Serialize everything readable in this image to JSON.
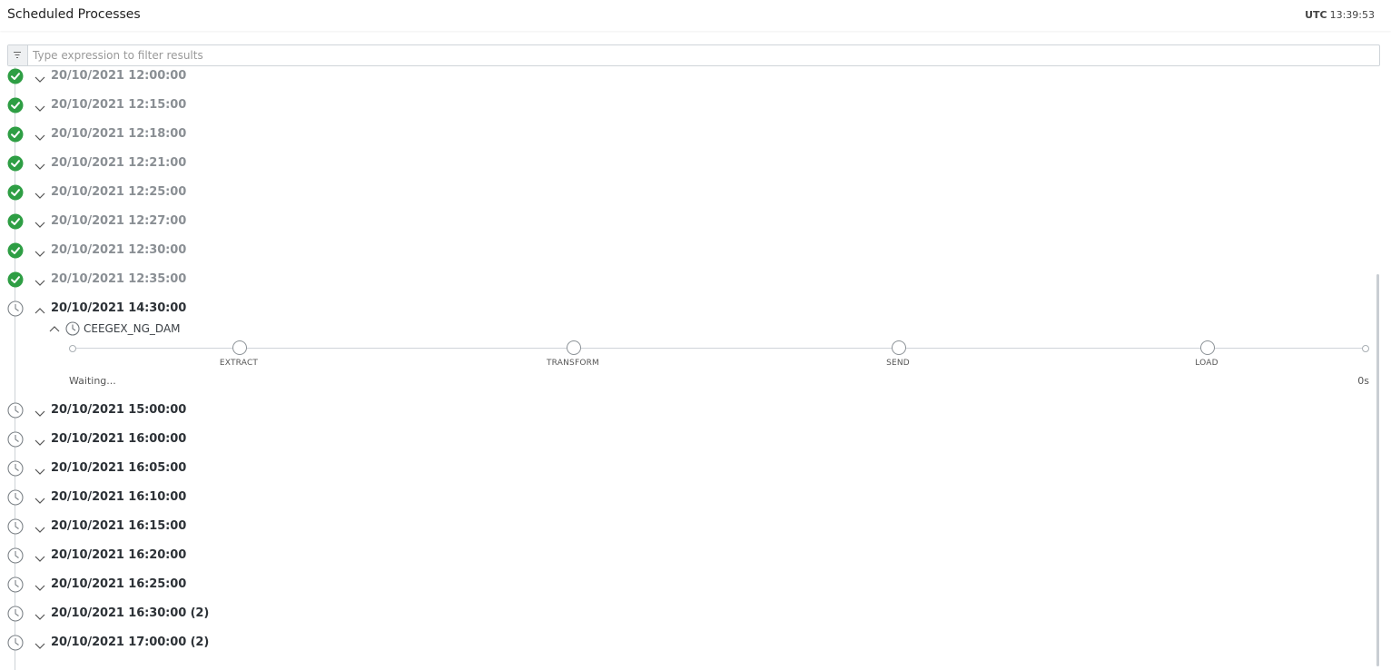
{
  "header": {
    "title": "Scheduled Processes",
    "timezone": "UTC",
    "time": "13:39:53"
  },
  "filter": {
    "placeholder": "Type expression to filter results",
    "value": "",
    "icon": "filter-icon"
  },
  "colors": {
    "success": "#2e9e44",
    "pending_icon": "#7d8388",
    "timeline": "#cdd2d6"
  },
  "runs_done": [
    {
      "label": "20/10/2021 12:00:00",
      "status": "success"
    },
    {
      "label": "20/10/2021 12:15:00",
      "status": "success"
    },
    {
      "label": "20/10/2021 12:18:00",
      "status": "success"
    },
    {
      "label": "20/10/2021 12:21:00",
      "status": "success"
    },
    {
      "label": "20/10/2021 12:25:00",
      "status": "success"
    },
    {
      "label": "20/10/2021 12:27:00",
      "status": "success"
    },
    {
      "label": "20/10/2021 12:30:00",
      "status": "success"
    },
    {
      "label": "20/10/2021 12:35:00",
      "status": "success"
    }
  ],
  "expanded_run": {
    "label": "20/10/2021 14:30:00",
    "status": "scheduled",
    "process": {
      "name": "CEEGEX_NG_DAM",
      "stages": [
        "EXTRACT",
        "TRANSFORM",
        "SEND",
        "LOAD"
      ],
      "state_text": "Waiting...",
      "duration": "0s"
    }
  },
  "runs_pending": [
    {
      "label": "20/10/2021 15:00:00",
      "status": "scheduled"
    },
    {
      "label": "20/10/2021 16:00:00",
      "status": "scheduled"
    },
    {
      "label": "20/10/2021 16:05:00",
      "status": "scheduled"
    },
    {
      "label": "20/10/2021 16:10:00",
      "status": "scheduled"
    },
    {
      "label": "20/10/2021 16:15:00",
      "status": "scheduled"
    },
    {
      "label": "20/10/2021 16:20:00",
      "status": "scheduled"
    },
    {
      "label": "20/10/2021 16:25:00",
      "status": "scheduled"
    },
    {
      "label": "20/10/2021 16:30:00 (2)",
      "status": "scheduled"
    },
    {
      "label": "20/10/2021 17:00:00 (2)",
      "status": "scheduled"
    }
  ]
}
